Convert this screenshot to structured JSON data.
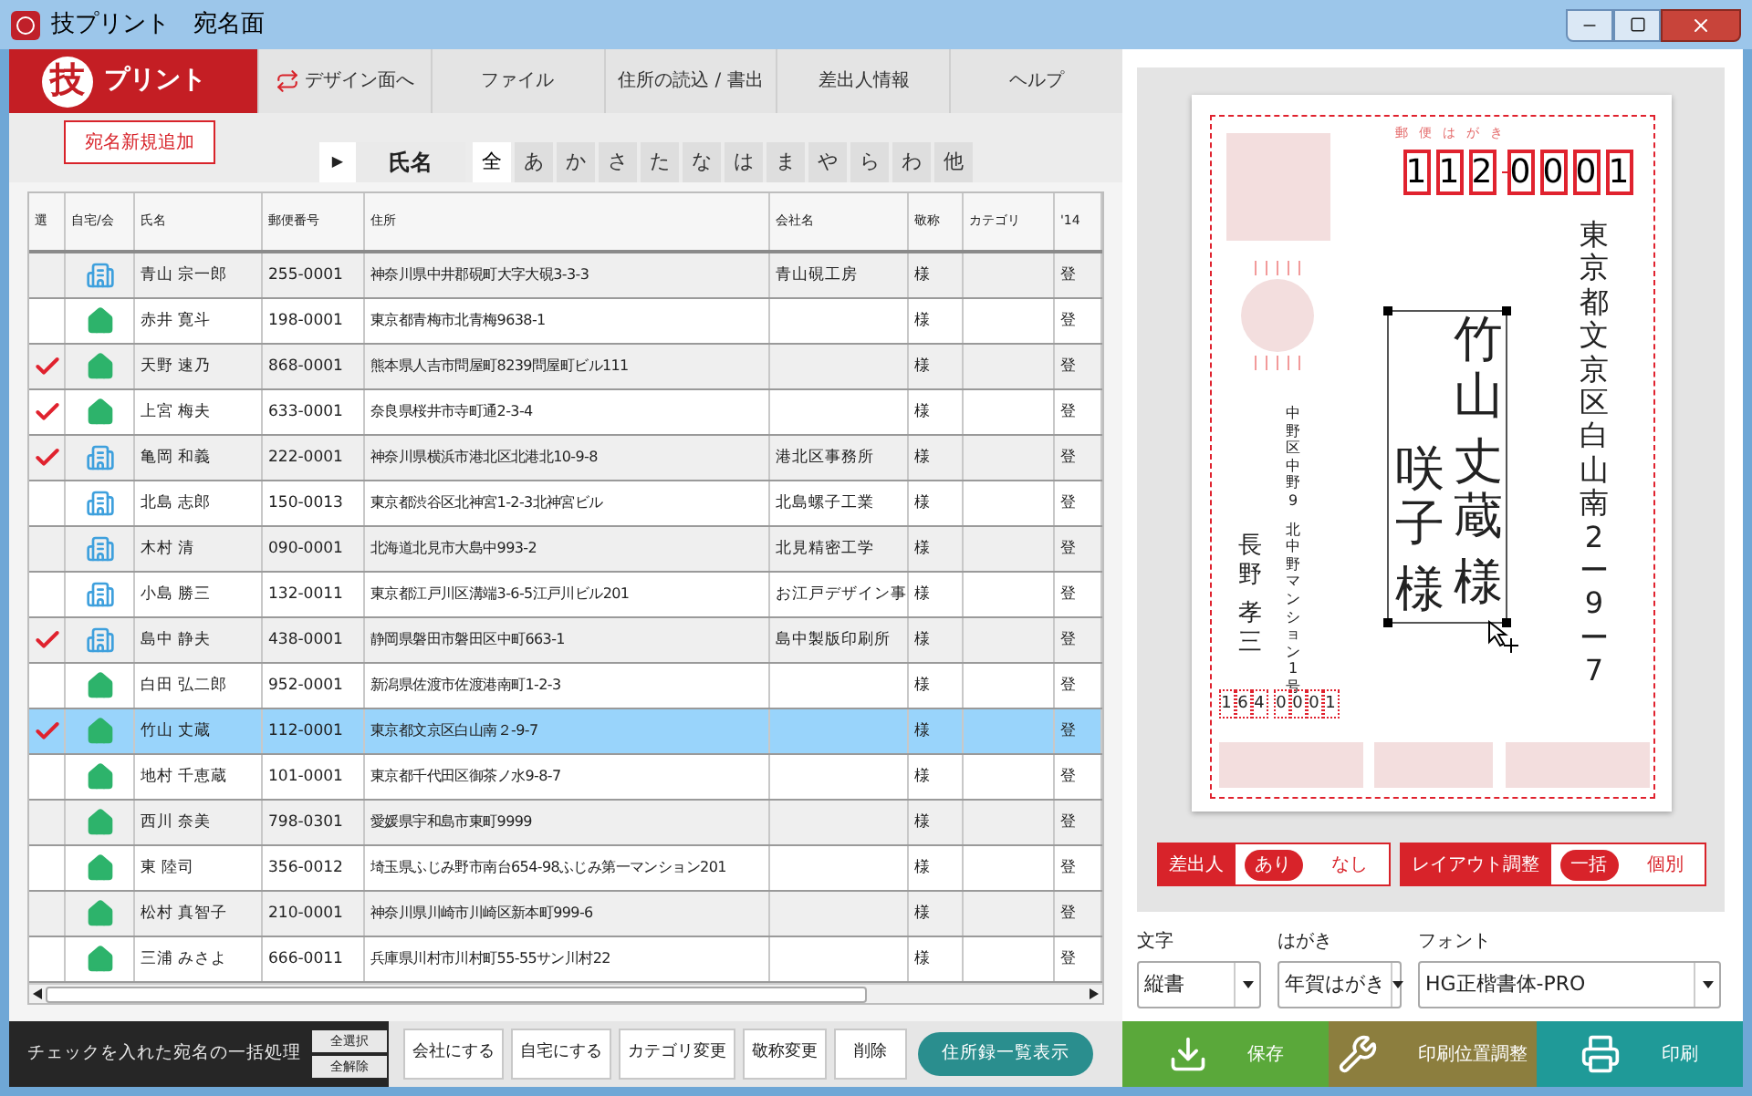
{
  "window": {
    "title": "技プリント　宛名面"
  },
  "brand": {
    "mark": "技",
    "name": "プリント"
  },
  "menu": [
    {
      "label": "デザイン面へ",
      "kind": "swap"
    },
    {
      "label": "ファイル",
      "kind": "plain"
    },
    {
      "label": "住所の読込 / 書出",
      "kind": "plain"
    },
    {
      "label": "差出人情報",
      "kind": "plain"
    },
    {
      "label": "ヘルプ",
      "kind": "plain"
    }
  ],
  "add_button": "宛名新規追加",
  "sort_field": {
    "arrow": "▶",
    "label": "氏名"
  },
  "index_tabs": [
    {
      "label": "全",
      "selected": true
    },
    {
      "label": "あ",
      "selected": false
    },
    {
      "label": "か",
      "selected": false
    },
    {
      "label": "さ",
      "selected": false
    },
    {
      "label": "た",
      "selected": false
    },
    {
      "label": "な",
      "selected": false
    },
    {
      "label": "は",
      "selected": false
    },
    {
      "label": "ま",
      "selected": false
    },
    {
      "label": "や",
      "selected": false
    },
    {
      "label": "ら",
      "selected": false
    },
    {
      "label": "わ",
      "selected": false
    },
    {
      "label": "他",
      "selected": false
    }
  ],
  "table": {
    "columns": [
      "選",
      "自宅/会",
      "氏名",
      "郵便番号",
      "住所",
      "会社名",
      "敬称",
      "カテゴリ",
      "'14"
    ],
    "rows": [
      {
        "checked": false,
        "kind": "company",
        "selected": false,
        "name": "青山 宗一郎",
        "postal": "255-0001",
        "address": "神奈川県中井郡硯町大字大硯3-3-3",
        "company": "青山硯工房",
        "honorific": "様",
        "column_9": "登"
      },
      {
        "checked": false,
        "kind": "home",
        "selected": false,
        "name": "赤井 寛斗",
        "postal": "198-0001",
        "address": "東京都青梅市北青梅9638-1",
        "company": "",
        "honorific": "様",
        "column_9": "登"
      },
      {
        "checked": true,
        "kind": "home",
        "selected": false,
        "name": "天野 速乃",
        "postal": "868-0001",
        "address": "熊本県人吉市問屋町8239問屋町ビル111",
        "company": "",
        "honorific": "様",
        "column_9": "登"
      },
      {
        "checked": true,
        "kind": "home",
        "selected": false,
        "name": "上宮 梅夫",
        "postal": "633-0001",
        "address": "奈良県桜井市寺町通2-3-4",
        "company": "",
        "honorific": "様",
        "column_9": "登"
      },
      {
        "checked": true,
        "kind": "company",
        "selected": false,
        "name": "亀岡 和義",
        "postal": "222-0001",
        "address": "神奈川県横浜市港北区北港北10-9-8",
        "company": "港北区事務所",
        "honorific": "様",
        "column_9": "登"
      },
      {
        "checked": false,
        "kind": "company",
        "selected": false,
        "name": "北島 志郎",
        "postal": "150-0013",
        "address": "東京都渋谷区北神宮1-2-3北神宮ビル",
        "company": "北島螺子工業",
        "honorific": "様",
        "column_9": "登"
      },
      {
        "checked": false,
        "kind": "company",
        "selected": false,
        "name": "木村 清",
        "postal": "090-0001",
        "address": "北海道北見市大島中993-2",
        "company": "北見精密工学",
        "honorific": "様",
        "column_9": "登"
      },
      {
        "checked": false,
        "kind": "company",
        "selected": false,
        "name": "小島 勝三",
        "postal": "132-0011",
        "address": "東京都江戸川区溝端3-6-5江戸川ビル201",
        "company": "お江戸デザイン事",
        "honorific": "様",
        "column_9": "登"
      },
      {
        "checked": true,
        "kind": "company",
        "selected": false,
        "name": "島中 静夫",
        "postal": "438-0001",
        "address": "静岡県磐田市磐田区中町663-1",
        "company": "島中製版印刷所",
        "honorific": "様",
        "column_9": "登"
      },
      {
        "checked": false,
        "kind": "home",
        "selected": false,
        "name": "白田 弘二郎",
        "postal": "952-0001",
        "address": "新潟県佐渡市佐渡港南町1-2-3",
        "company": "",
        "honorific": "様",
        "column_9": "登"
      },
      {
        "checked": true,
        "kind": "home",
        "selected": true,
        "name": "竹山 丈蔵",
        "postal": "112-0001",
        "address": "東京都文京区白山南２-9-7",
        "company": "",
        "honorific": "様",
        "column_9": "登"
      },
      {
        "checked": false,
        "kind": "home",
        "selected": false,
        "name": "地村 千恵蔵",
        "postal": "101-0001",
        "address": "東京都千代田区御茶ノ水9-8-7",
        "company": "",
        "honorific": "様",
        "column_9": "登"
      },
      {
        "checked": false,
        "kind": "home",
        "selected": false,
        "name": "西川 奈美",
        "postal": "798-0301",
        "address": "愛媛県宇和島市東町9999",
        "company": "",
        "honorific": "様",
        "column_9": "登"
      },
      {
        "checked": false,
        "kind": "home",
        "selected": false,
        "name": "東 陸司",
        "postal": "356-0012",
        "address": "埼玉県ふじみ野市南台654-98ふじみ第一マンション201",
        "company": "",
        "honorific": "様",
        "column_9": "登"
      },
      {
        "checked": false,
        "kind": "home",
        "selected": false,
        "name": "松村 真智子",
        "postal": "210-0001",
        "address": "神奈川県川崎市川崎区新本町999-6",
        "company": "",
        "honorific": "様",
        "column_9": "登"
      },
      {
        "checked": false,
        "kind": "home",
        "selected": false,
        "name": "三浦 みさよ",
        "postal": "666-0011",
        "address": "兵庫県川村市川村町55-55サン川村22",
        "company": "",
        "honorific": "様",
        "column_9": "登"
      }
    ]
  },
  "batch": {
    "label": "チェックを入れた宛名の一括処理",
    "select_all": "全選択",
    "clear_all": "全解除",
    "buttons": [
      "会社にする",
      "自宅にする",
      "カテゴリ変更",
      "敬称変更",
      "削除"
    ],
    "list_button": "住所録一覧表示"
  },
  "postcard": {
    "header": "郵便はがき",
    "postal": [
      [
        "1",
        "1",
        "2"
      ],
      [
        "0",
        "0",
        "0",
        "1"
      ]
    ],
    "address": "東京都文京区白山南2ー9ー7",
    "recipient": {
      "family": "竹山",
      "given": "丈蔵",
      "honorific": "様"
    },
    "joint": {
      "given": "咲子",
      "honorific": "様"
    },
    "sender": {
      "address": [
        "中野区中野9",
        "北中野マンション1号"
      ],
      "family": "長野",
      "given": "孝三",
      "postal": [
        [
          "1",
          "6",
          "4"
        ],
        [
          "0",
          "0",
          "0",
          "1"
        ]
      ]
    }
  },
  "toggles": [
    {
      "label": "差出人",
      "options": [
        {
          "label": "あり",
          "selected": true
        },
        {
          "label": "なし",
          "selected": false
        }
      ]
    },
    {
      "label": "レイアウト調整",
      "options": [
        {
          "label": "一括",
          "selected": true
        },
        {
          "label": "個別",
          "selected": false
        }
      ]
    }
  ],
  "selects": [
    {
      "label": "文字",
      "value": "縦書"
    },
    {
      "label": "はがき",
      "value": "年賀はがき"
    },
    {
      "label": "フォント",
      "value": "HG正楷書体-PRO"
    }
  ],
  "actions": [
    {
      "label": "保存",
      "kind": "save"
    },
    {
      "label": "印刷位置調整",
      "kind": "adjust"
    },
    {
      "label": "印刷",
      "kind": "print"
    }
  ]
}
